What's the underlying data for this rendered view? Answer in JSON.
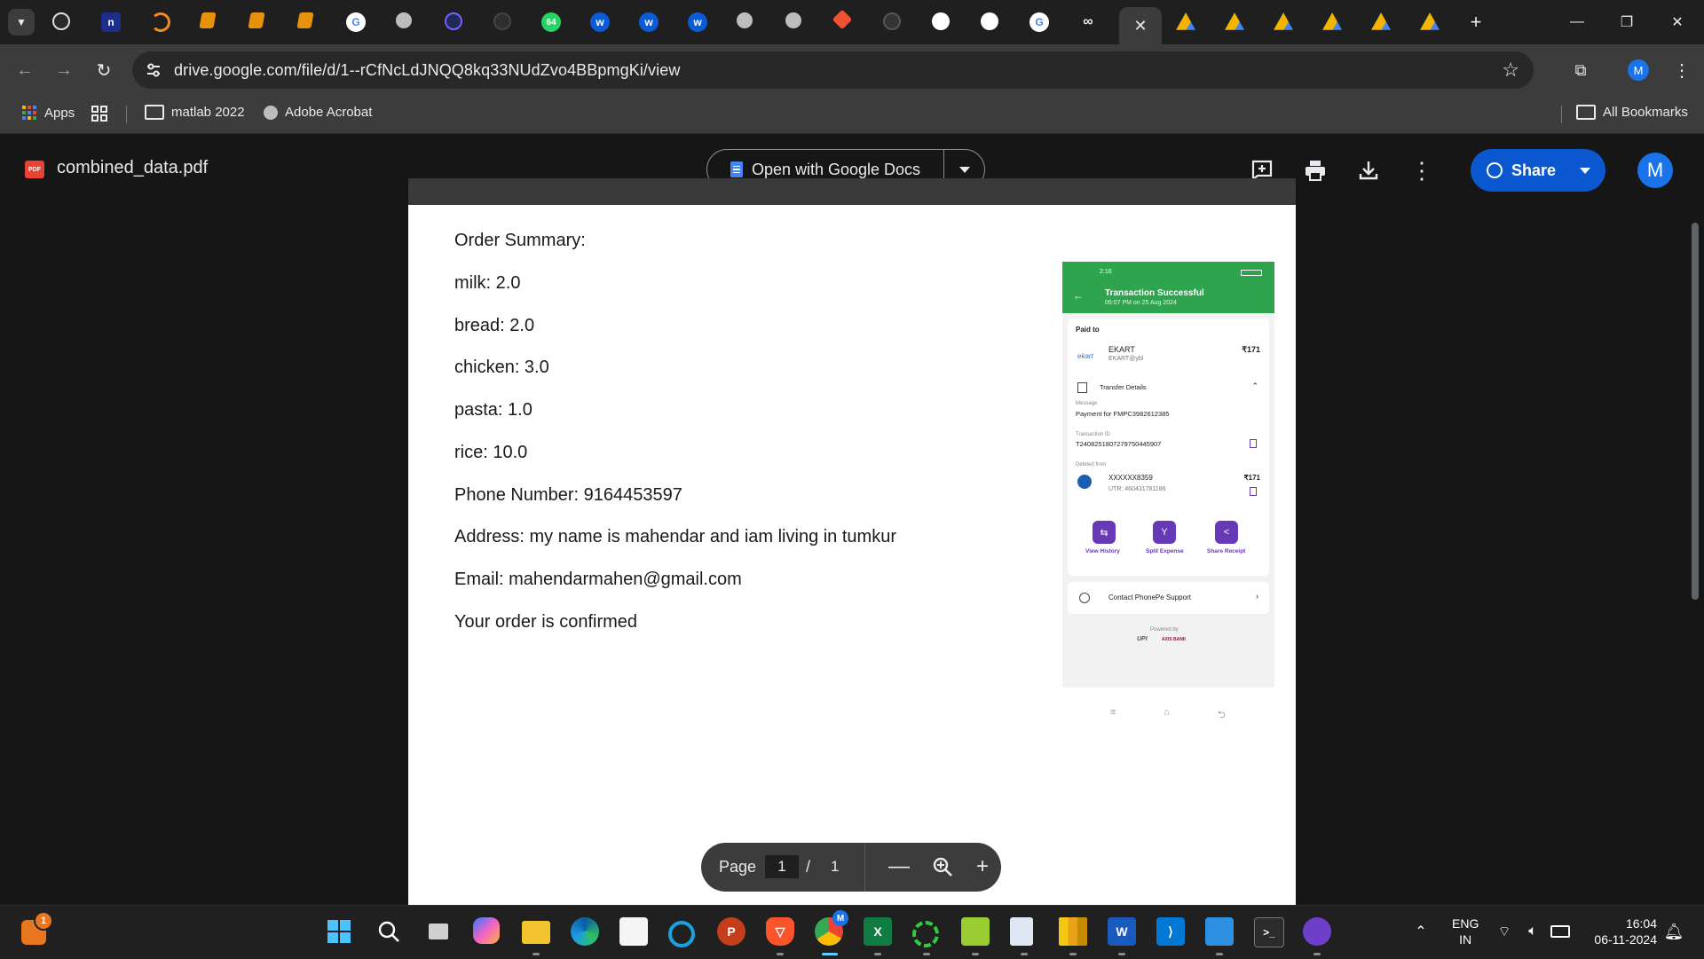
{
  "browser": {
    "url": "drive.google.com/file/d/1--rCfNcLdJNQQ8kq33NUdZvo4BBpmgKi/view",
    "tab_badge": "64",
    "profile_initial": "M"
  },
  "bookmarks": {
    "apps": "Apps",
    "matlab": "matlab 2022",
    "acrobat": "Adobe Acrobat",
    "all": "All Bookmarks"
  },
  "drive": {
    "file_badge": "PDF",
    "filename": "combined_data.pdf",
    "open_with": "Open with Google Docs",
    "share": "Share",
    "account_initial": "M"
  },
  "document": {
    "lines": [
      "Order Summary:",
      "milk: 2.0",
      "bread: 2.0",
      "chicken: 3.0",
      "pasta: 1.0",
      "rice: 10.0",
      "Phone Number: 9164453597",
      "Address: my name is mahendar and iam living in tumkur",
      "Email: mahendarmahen@gmail.com",
      "Your order is confirmed"
    ]
  },
  "receipt": {
    "status_time": "2:16",
    "title": "Transaction Successful",
    "subtitle": "06:07 PM on 25 Aug 2024",
    "paid_to": "Paid to",
    "merchant_logo": "ekart",
    "merchant": "EKART",
    "merchant_upi": "EKART@ybl",
    "amount": "₹171",
    "transfer_details": "Transfer Details",
    "message_label": "Message",
    "message": "Payment for FMPC3982612385",
    "txn_label": "Transaction ID",
    "txn_id": "T2408251807279750445907",
    "debited_label": "Debited from",
    "account": "XXXXXX8359",
    "debit_amount": "₹171",
    "utr": "UTR: 460431781186",
    "action_history": "View History",
    "action_split": "Split Expense",
    "action_share": "Share Receipt",
    "support": "Contact PhonePe Support",
    "powered": "Powered by",
    "upi_logo": "UPI",
    "bank_logo": "AXIS BANK"
  },
  "pager": {
    "label": "Page",
    "current": "1",
    "separator": "/",
    "total": "1"
  },
  "taskbar": {
    "notification_count": "1",
    "chrome_badge": "M",
    "lang_1": "ENG",
    "lang_2": "IN",
    "time": "16:04",
    "date": "06-11-2024"
  },
  "colors": {
    "share_blue": "#0b57d0",
    "phonepe_green": "#2fa44f",
    "phonepe_purple": "#6739b7"
  }
}
